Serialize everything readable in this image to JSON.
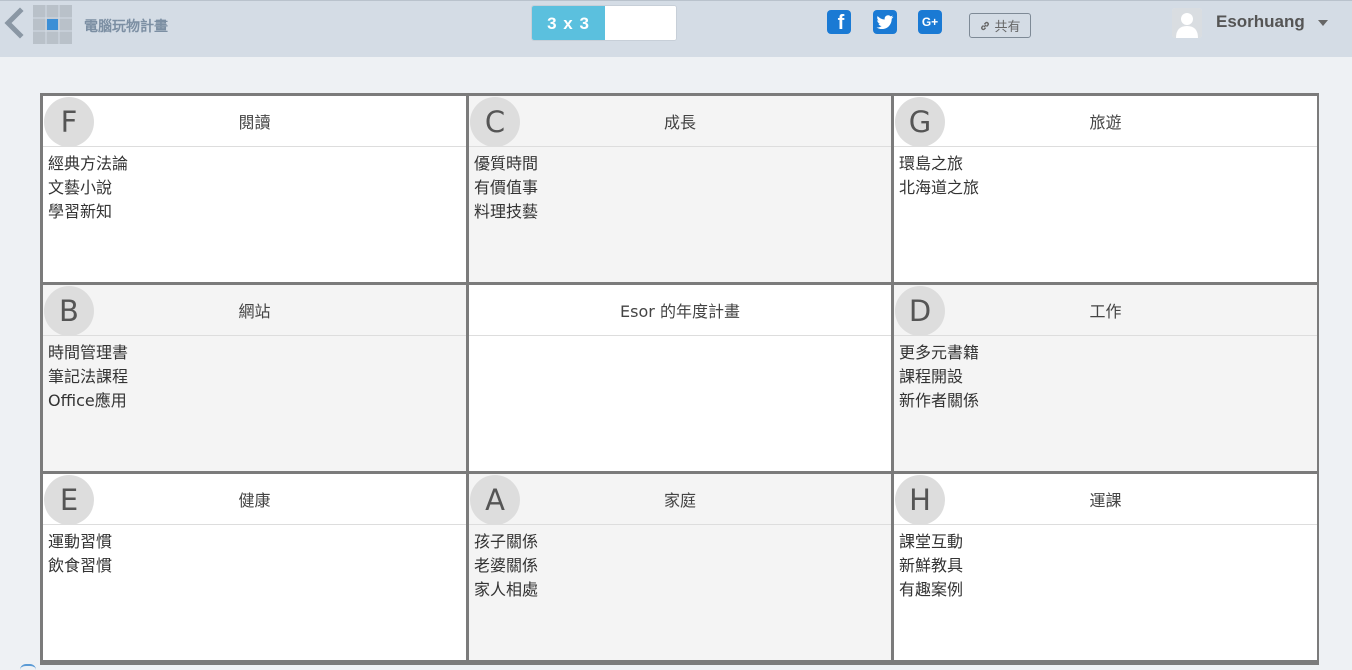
{
  "header": {
    "app_title": "電腦玩物計畫",
    "grid_size_label": "3 x 3",
    "share_label": "共有",
    "username": "Esorhuang",
    "social": {
      "facebook_glyph": "f",
      "twitter_glyph": "t",
      "gplus_glyph": "G+"
    },
    "accent_color": "#5bc0de",
    "social_color": "#1a7ad4"
  },
  "board": {
    "center_title": "Esor 的年度計畫",
    "cells": [
      {
        "badge": "F",
        "title": "閱讀",
        "items": [
          "經典方法論",
          "文藝小說",
          "學習新知"
        ]
      },
      {
        "badge": "C",
        "title": "成長",
        "items": [
          "優質時間",
          "有價值事",
          "料理技藝"
        ]
      },
      {
        "badge": "G",
        "title": "旅遊",
        "items": [
          "環島之旅",
          "北海道之旅"
        ]
      },
      {
        "badge": "B",
        "title": "網站",
        "items": [
          "時間管理書",
          "筆記法課程",
          "Office應用"
        ]
      },
      {
        "badge": "D",
        "title": "工作",
        "items": [
          "更多元書籍",
          "課程開設",
          "新作者關係"
        ]
      },
      {
        "badge": "E",
        "title": "健康",
        "items": [
          "運動習慣",
          "飲食習慣"
        ]
      },
      {
        "badge": "A",
        "title": "家庭",
        "items": [
          "孩子關係",
          "老婆關係",
          "家人相處"
        ]
      },
      {
        "badge": "H",
        "title": "運課",
        "items": [
          "課堂互動",
          "新鮮教具",
          "有趣案例"
        ]
      }
    ]
  }
}
